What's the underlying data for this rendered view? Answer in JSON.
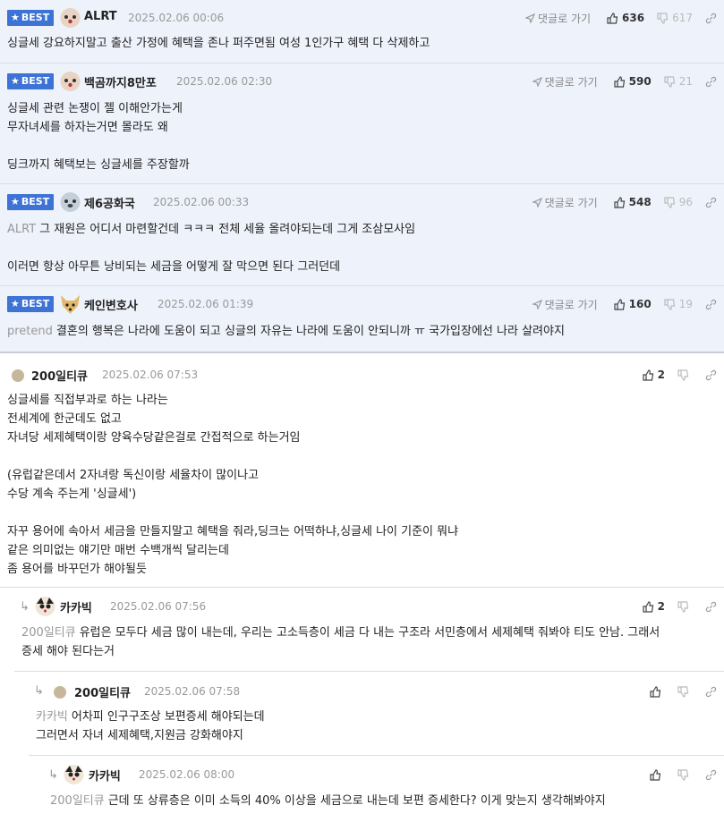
{
  "reply_label": "댓글로 가기",
  "best_label": "BEST",
  "comments": [
    {
      "nick": "ALRT",
      "date": "2025.02.06 00:06",
      "up": "636",
      "down": "617",
      "text": "싱글세 강요하지말고 출산 가정에 혜택을 존나 퍼주면됨 여성 1인가구 혜택 다 삭제하고"
    },
    {
      "nick": "백곰까지8만포",
      "date": "2025.02.06 02:30",
      "up": "590",
      "down": "21",
      "text": "싱글세 관련 논쟁이 젤 이해안가는게\n무자녀세를 하자는거면 몰라도 왜\n\n딩크까지 혜택보는 싱글세를 주장할까"
    },
    {
      "nick": "제6공화국",
      "date": "2025.02.06 00:33",
      "up": "548",
      "down": "96",
      "mention": "ALRT",
      "text": "그 재원은 어디서 마련할건데 ㅋㅋㅋ 전체 세율 올려야되는데 그게 조삼모사임\n\n이러면 항상 아무튼 낭비되는 세금을 어떻게 잘 막으면 된다 그러던데"
    },
    {
      "nick": "케인변호사",
      "date": "2025.02.06 01:39",
      "up": "160",
      "down": "19",
      "mention": "pretend",
      "text": "결혼의 행복은 나라에 도움이 되고 싱글의 자유는 나라에 도움이 안되니까 ㅠ 국가입장에선 나라 살려야지"
    },
    {
      "nick": "200일티큐",
      "date": "2025.02.06 07:53",
      "up": "2",
      "text": "싱글세를 직접부과로 하는 나라는\n전세계에 한군데도 없고\n자녀당 세제혜택이랑 양육수당같은걸로 간접적으로 하는거임\n\n(유럽같은데서 2자녀랑 독신이랑 세율차이 많이나고\n수당 계속 주는게 '싱글세')\n\n자꾸 용어에 속아서 세금을 만들지말고 혜택을 줘라,딩크는 어떡하냐,싱글세 나이 기준이 뭐냐\n같은 의미없는 얘기만 매번 수백개씩 달리는데\n좀 용어를 바꾸던가 해야될듯"
    },
    {
      "nick": "카카빅",
      "date": "2025.02.06 07:56",
      "up": "2",
      "mention": "200일티큐",
      "text": "유럽은 모두다 세금 많이 내는데, 우리는 고소득층이 세금 다 내는 구조라 서민층에서 세제혜택 줘봐야 티도 안남. 그래서\n증세 해야 된다는거"
    },
    {
      "nick": "200일티큐",
      "date": "2025.02.06 07:58",
      "mention": "카카빅",
      "text": "어차피 인구구조상 보편증세 해야되는데\n그러면서 자녀 세제혜택,지원금 강화해야지"
    },
    {
      "nick": "카카빅",
      "date": "2025.02.06 08:00",
      "mention": "200일티큐",
      "text": "근데 또 상류층은 이미 소득의 40% 이상을 세금으로 내는데 보편 증세한다? 이게 맞는지 생각해봐야지"
    }
  ]
}
